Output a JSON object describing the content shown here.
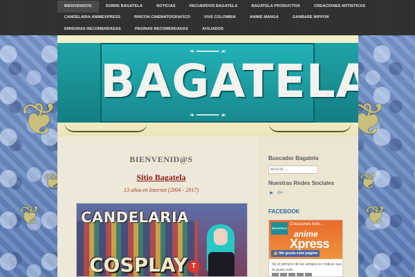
{
  "nav": {
    "row1": [
      "BIENVENIDOS",
      "SOBRE BAGATELA",
      "NOTICIAS",
      "RECUERDOS BAGATELA",
      "BAGATELA PRODUCTIVA",
      "CREACIONES ARTISTICAS"
    ],
    "row2": [
      "CANDELARIA ANIMEXPRESS",
      "RINCON CINEMATOGRAFICO",
      "VIVE COLOMBIA",
      "ANIME MANGA",
      "GANBARE NIPPON"
    ],
    "row3": [
      "EMISORAS RECOMENDADAS",
      "PAGINAS RECOMENDADAS",
      "AFILIADOS"
    ],
    "active": "BIENVENIDOS"
  },
  "header": {
    "title": "BAGATELA"
  },
  "main": {
    "welcome": "BIENVENID@S",
    "site_title": "Sitio Bagatela",
    "years": "13 años en Internet (2004 - 2017)",
    "promo": {
      "line1": "CANDELARIA",
      "line2": "COSPLAY"
    }
  },
  "sidebar": {
    "search_title": "Buscador Bagatela",
    "search_placeholder": "Buscar ...",
    "social_title": "Nuestras Redes Sociales",
    "facebook_title": "FACEBOOK",
    "fb": {
      "page_name": "Creaciones Artis...",
      "thumb_text": "BAGATELA",
      "logo_line1": "anime",
      "logo_line2": "Xpress",
      "like_label": "Me gusta esta página",
      "friends_text": "Sé el primero de tus amigos en indicar que te gusta esto."
    }
  },
  "colors": {
    "teal": "#1fa3a6",
    "nav_bg": "#2f2f2f",
    "title_red": "#8b1a1a"
  }
}
